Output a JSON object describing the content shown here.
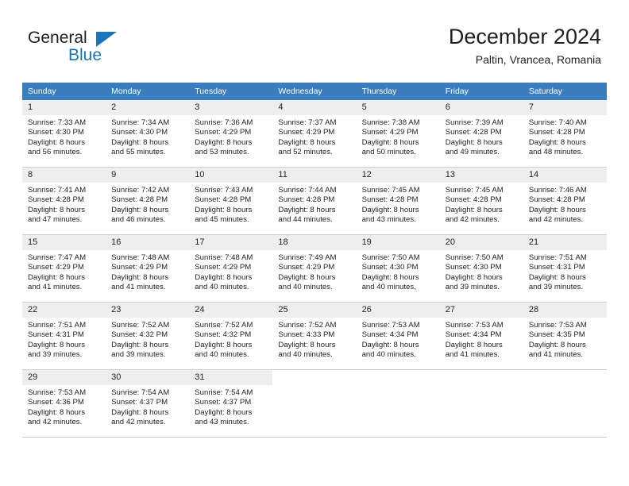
{
  "logo": {
    "word1": "General",
    "word2": "Blue",
    "triangle_color": "#1b75bb"
  },
  "header": {
    "title": "December 2024",
    "subtitle": "Paltin, Vrancea, Romania",
    "accent_color": "#3a7dbf",
    "daynum_band_color": "#eeeeee"
  },
  "weekdays": [
    "Sunday",
    "Monday",
    "Tuesday",
    "Wednesday",
    "Thursday",
    "Friday",
    "Saturday"
  ],
  "labels": {
    "sunrise": "Sunrise:",
    "sunset": "Sunset:",
    "daylight": "Daylight:"
  },
  "weeks": [
    [
      {
        "day": "1",
        "sunrise": "Sunrise: 7:33 AM",
        "sunset": "Sunset: 4:30 PM",
        "daylight1": "Daylight: 8 hours",
        "daylight2": "and 56 minutes."
      },
      {
        "day": "2",
        "sunrise": "Sunrise: 7:34 AM",
        "sunset": "Sunset: 4:30 PM",
        "daylight1": "Daylight: 8 hours",
        "daylight2": "and 55 minutes."
      },
      {
        "day": "3",
        "sunrise": "Sunrise: 7:36 AM",
        "sunset": "Sunset: 4:29 PM",
        "daylight1": "Daylight: 8 hours",
        "daylight2": "and 53 minutes."
      },
      {
        "day": "4",
        "sunrise": "Sunrise: 7:37 AM",
        "sunset": "Sunset: 4:29 PM",
        "daylight1": "Daylight: 8 hours",
        "daylight2": "and 52 minutes."
      },
      {
        "day": "5",
        "sunrise": "Sunrise: 7:38 AM",
        "sunset": "Sunset: 4:29 PM",
        "daylight1": "Daylight: 8 hours",
        "daylight2": "and 50 minutes."
      },
      {
        "day": "6",
        "sunrise": "Sunrise: 7:39 AM",
        "sunset": "Sunset: 4:28 PM",
        "daylight1": "Daylight: 8 hours",
        "daylight2": "and 49 minutes."
      },
      {
        "day": "7",
        "sunrise": "Sunrise: 7:40 AM",
        "sunset": "Sunset: 4:28 PM",
        "daylight1": "Daylight: 8 hours",
        "daylight2": "and 48 minutes."
      }
    ],
    [
      {
        "day": "8",
        "sunrise": "Sunrise: 7:41 AM",
        "sunset": "Sunset: 4:28 PM",
        "daylight1": "Daylight: 8 hours",
        "daylight2": "and 47 minutes."
      },
      {
        "day": "9",
        "sunrise": "Sunrise: 7:42 AM",
        "sunset": "Sunset: 4:28 PM",
        "daylight1": "Daylight: 8 hours",
        "daylight2": "and 46 minutes."
      },
      {
        "day": "10",
        "sunrise": "Sunrise: 7:43 AM",
        "sunset": "Sunset: 4:28 PM",
        "daylight1": "Daylight: 8 hours",
        "daylight2": "and 45 minutes."
      },
      {
        "day": "11",
        "sunrise": "Sunrise: 7:44 AM",
        "sunset": "Sunset: 4:28 PM",
        "daylight1": "Daylight: 8 hours",
        "daylight2": "and 44 minutes."
      },
      {
        "day": "12",
        "sunrise": "Sunrise: 7:45 AM",
        "sunset": "Sunset: 4:28 PM",
        "daylight1": "Daylight: 8 hours",
        "daylight2": "and 43 minutes."
      },
      {
        "day": "13",
        "sunrise": "Sunrise: 7:45 AM",
        "sunset": "Sunset: 4:28 PM",
        "daylight1": "Daylight: 8 hours",
        "daylight2": "and 42 minutes."
      },
      {
        "day": "14",
        "sunrise": "Sunrise: 7:46 AM",
        "sunset": "Sunset: 4:28 PM",
        "daylight1": "Daylight: 8 hours",
        "daylight2": "and 42 minutes."
      }
    ],
    [
      {
        "day": "15",
        "sunrise": "Sunrise: 7:47 AM",
        "sunset": "Sunset: 4:29 PM",
        "daylight1": "Daylight: 8 hours",
        "daylight2": "and 41 minutes."
      },
      {
        "day": "16",
        "sunrise": "Sunrise: 7:48 AM",
        "sunset": "Sunset: 4:29 PM",
        "daylight1": "Daylight: 8 hours",
        "daylight2": "and 41 minutes."
      },
      {
        "day": "17",
        "sunrise": "Sunrise: 7:48 AM",
        "sunset": "Sunset: 4:29 PM",
        "daylight1": "Daylight: 8 hours",
        "daylight2": "and 40 minutes."
      },
      {
        "day": "18",
        "sunrise": "Sunrise: 7:49 AM",
        "sunset": "Sunset: 4:29 PM",
        "daylight1": "Daylight: 8 hours",
        "daylight2": "and 40 minutes."
      },
      {
        "day": "19",
        "sunrise": "Sunrise: 7:50 AM",
        "sunset": "Sunset: 4:30 PM",
        "daylight1": "Daylight: 8 hours",
        "daylight2": "and 40 minutes."
      },
      {
        "day": "20",
        "sunrise": "Sunrise: 7:50 AM",
        "sunset": "Sunset: 4:30 PM",
        "daylight1": "Daylight: 8 hours",
        "daylight2": "and 39 minutes."
      },
      {
        "day": "21",
        "sunrise": "Sunrise: 7:51 AM",
        "sunset": "Sunset: 4:31 PM",
        "daylight1": "Daylight: 8 hours",
        "daylight2": "and 39 minutes."
      }
    ],
    [
      {
        "day": "22",
        "sunrise": "Sunrise: 7:51 AM",
        "sunset": "Sunset: 4:31 PM",
        "daylight1": "Daylight: 8 hours",
        "daylight2": "and 39 minutes."
      },
      {
        "day": "23",
        "sunrise": "Sunrise: 7:52 AM",
        "sunset": "Sunset: 4:32 PM",
        "daylight1": "Daylight: 8 hours",
        "daylight2": "and 39 minutes."
      },
      {
        "day": "24",
        "sunrise": "Sunrise: 7:52 AM",
        "sunset": "Sunset: 4:32 PM",
        "daylight1": "Daylight: 8 hours",
        "daylight2": "and 40 minutes."
      },
      {
        "day": "25",
        "sunrise": "Sunrise: 7:52 AM",
        "sunset": "Sunset: 4:33 PM",
        "daylight1": "Daylight: 8 hours",
        "daylight2": "and 40 minutes."
      },
      {
        "day": "26",
        "sunrise": "Sunrise: 7:53 AM",
        "sunset": "Sunset: 4:34 PM",
        "daylight1": "Daylight: 8 hours",
        "daylight2": "and 40 minutes."
      },
      {
        "day": "27",
        "sunrise": "Sunrise: 7:53 AM",
        "sunset": "Sunset: 4:34 PM",
        "daylight1": "Daylight: 8 hours",
        "daylight2": "and 41 minutes."
      },
      {
        "day": "28",
        "sunrise": "Sunrise: 7:53 AM",
        "sunset": "Sunset: 4:35 PM",
        "daylight1": "Daylight: 8 hours",
        "daylight2": "and 41 minutes."
      }
    ],
    [
      {
        "day": "29",
        "sunrise": "Sunrise: 7:53 AM",
        "sunset": "Sunset: 4:36 PM",
        "daylight1": "Daylight: 8 hours",
        "daylight2": "and 42 minutes."
      },
      {
        "day": "30",
        "sunrise": "Sunrise: 7:54 AM",
        "sunset": "Sunset: 4:37 PM",
        "daylight1": "Daylight: 8 hours",
        "daylight2": "and 42 minutes."
      },
      {
        "day": "31",
        "sunrise": "Sunrise: 7:54 AM",
        "sunset": "Sunset: 4:37 PM",
        "daylight1": "Daylight: 8 hours",
        "daylight2": "and 43 minutes."
      },
      {
        "day": "",
        "sunrise": "",
        "sunset": "",
        "daylight1": "",
        "daylight2": ""
      },
      {
        "day": "",
        "sunrise": "",
        "sunset": "",
        "daylight1": "",
        "daylight2": ""
      },
      {
        "day": "",
        "sunrise": "",
        "sunset": "",
        "daylight1": "",
        "daylight2": ""
      },
      {
        "day": "",
        "sunrise": "",
        "sunset": "",
        "daylight1": "",
        "daylight2": ""
      }
    ]
  ]
}
